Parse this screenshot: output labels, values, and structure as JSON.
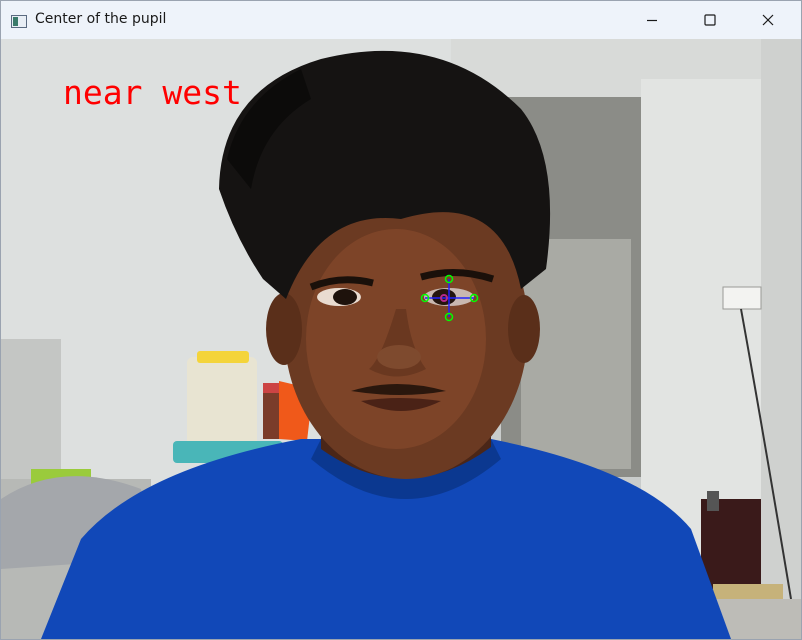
{
  "window": {
    "title": "Center of the pupil",
    "controls": {
      "minimize": "minimize-icon",
      "maximize": "maximize-icon",
      "close": "close-icon"
    }
  },
  "frame": {
    "overlay_text": "near west",
    "overlay_color": "#ff0000",
    "marker_color": "#00ff00",
    "pupil_color": "#1a2a8a"
  }
}
